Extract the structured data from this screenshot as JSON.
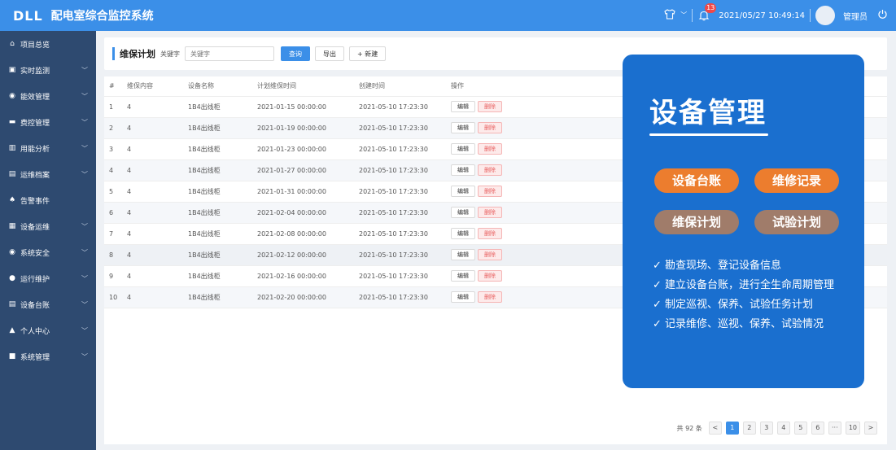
{
  "header": {
    "logo": "DLL",
    "title": "配电室综合监控系统",
    "notification_count": "13",
    "datetime": "2021/05/27 10:49:14",
    "user": "管理员"
  },
  "sidebar": {
    "items": [
      {
        "label": "项目总览",
        "icon": "home-icon",
        "glyph": "⌂",
        "chevron": false
      },
      {
        "label": "实时监测",
        "icon": "monitor-icon",
        "glyph": "▣",
        "chevron": true
      },
      {
        "label": "能效管理",
        "icon": "gauge-icon",
        "glyph": "◉",
        "chevron": true
      },
      {
        "label": "费控管理",
        "icon": "card-icon",
        "glyph": "▬",
        "chevron": true
      },
      {
        "label": "用能分析",
        "icon": "bar-chart-icon",
        "glyph": "▥",
        "chevron": true
      },
      {
        "label": "运维档案",
        "icon": "folder-icon",
        "glyph": "▤",
        "chevron": true
      },
      {
        "label": "告警事件",
        "icon": "bell-icon",
        "glyph": "♠",
        "chevron": false
      },
      {
        "label": "设备运维",
        "icon": "clipboard-icon",
        "glyph": "▦",
        "chevron": true
      },
      {
        "label": "系统安全",
        "icon": "shield-icon",
        "glyph": "◉",
        "chevron": true
      },
      {
        "label": "运行维护",
        "icon": "location-icon",
        "glyph": "●",
        "chevron": true
      },
      {
        "label": "设备台账",
        "icon": "ledger-icon",
        "glyph": "▤",
        "chevron": true
      },
      {
        "label": "个人中心",
        "icon": "user-icon",
        "glyph": "▲",
        "chevron": true
      },
      {
        "label": "系统管理",
        "icon": "settings-screen-icon",
        "glyph": "■",
        "chevron": true
      }
    ],
    "chevron_glyph": "﹀"
  },
  "toolbar": {
    "title": "维保计划",
    "keyword_label": "关键字",
    "keyword_placeholder": "关键字",
    "search_label": "查询",
    "export_label": "导出",
    "new_label": "+ 新建"
  },
  "table": {
    "headers": [
      "#",
      "维保内容",
      "设备名称",
      "计划维保时间",
      "创建时间",
      "操作"
    ],
    "edit_label": "编辑",
    "delete_label": "删除",
    "rows": [
      {
        "idx": "1",
        "content": "4",
        "device": "1B4出线柜",
        "planned": "2021-01-15 00:00:00",
        "created": "2021-05-10 17:23:30"
      },
      {
        "idx": "2",
        "content": "4",
        "device": "1B4出线柜",
        "planned": "2021-01-19 00:00:00",
        "created": "2021-05-10 17:23:30"
      },
      {
        "idx": "3",
        "content": "4",
        "device": "1B4出线柜",
        "planned": "2021-01-23 00:00:00",
        "created": "2021-05-10 17:23:30"
      },
      {
        "idx": "4",
        "content": "4",
        "device": "1B4出线柜",
        "planned": "2021-01-27 00:00:00",
        "created": "2021-05-10 17:23:30"
      },
      {
        "idx": "5",
        "content": "4",
        "device": "1B4出线柜",
        "planned": "2021-01-31 00:00:00",
        "created": "2021-05-10 17:23:30"
      },
      {
        "idx": "6",
        "content": "4",
        "device": "1B4出线柜",
        "planned": "2021-02-04 00:00:00",
        "created": "2021-05-10 17:23:30"
      },
      {
        "idx": "7",
        "content": "4",
        "device": "1B4出线柜",
        "planned": "2021-02-08 00:00:00",
        "created": "2021-05-10 17:23:30"
      },
      {
        "idx": "8",
        "content": "4",
        "device": "1B4出线柜",
        "planned": "2021-02-12 00:00:00",
        "created": "2021-05-10 17:23:30"
      },
      {
        "idx": "9",
        "content": "4",
        "device": "1B4出线柜",
        "planned": "2021-02-16 00:00:00",
        "created": "2021-05-10 17:23:30"
      },
      {
        "idx": "10",
        "content": "4",
        "device": "1B4出线柜",
        "planned": "2021-02-20 00:00:00",
        "created": "2021-05-10 17:23:30"
      }
    ]
  },
  "pagination": {
    "total": "共 92 条",
    "prev": "<",
    "next": ">",
    "pages": [
      "1",
      "2",
      "3",
      "4",
      "5",
      "6",
      "···",
      "10"
    ],
    "current": "1"
  },
  "overlay": {
    "title": "设备管理",
    "pills": [
      "设备台账",
      "维修记录",
      "维保计划",
      "试验计划"
    ],
    "bullets": [
      "✓ 勘查现场、登记设备信息",
      "✓ 建立设备台账，进行全生命周期管理",
      "✓ 制定巡视、保养、试验任务计划",
      "✓ 记录维修、巡视、保养、试验情况"
    ]
  },
  "colors": {
    "header": "#3b8fe8",
    "sidebar": "#2e4a70",
    "overlay": "#1a6fcf",
    "pill_orange": "#ec7d2e",
    "pill_brown": "#a07c6a"
  }
}
